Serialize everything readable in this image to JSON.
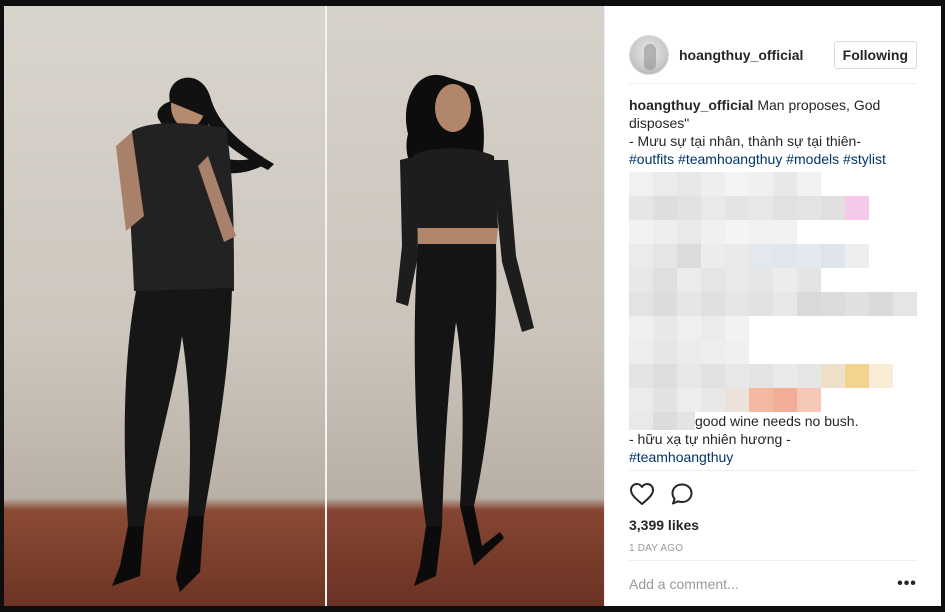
{
  "post": {
    "username": "hoangthuy_official",
    "follow_label": "Following"
  },
  "caption": {
    "username": "hoangthuy_official",
    "text_line1": " Man proposes, God disposes\"",
    "text_line2": "- Mưu sự tại nhân, thành sự tại thiên-",
    "hashtags": [
      "#outfits",
      "#teamhoangthuy",
      "#models",
      "#stylist"
    ],
    "text_line3": "good wine needs no bush.",
    "text_line4": "- hữu xạ tự nhiên hương -",
    "hashtag_end": "#teamhoangthuy"
  },
  "mosaic_colors": [
    [
      "#f1f1f1",
      "#ebebeb",
      "#e7e7e7",
      "#eeeeee",
      "#f3f3f3",
      "#f0f0f0",
      "#e8e8e8",
      "#f2f2f2",
      "#ffffff",
      "#ffffff",
      "#ffffff",
      "#ffffff"
    ],
    [
      "#e6e6e6",
      "#dedede",
      "#e2e2e2",
      "#e9e9e9",
      "#e4e4e4",
      "#e7e7e7",
      "#e1e1e1",
      "#e3e3e3",
      "#dfdfdf",
      "#f6c9ea",
      "#ffffff",
      "#ffffff"
    ],
    [
      "#f2f2f2",
      "#eeeeee",
      "#e9e9e9",
      "#f0f0f0",
      "#f4f4f4",
      "#f2f2f2",
      "#f1f1f1",
      "#ffffff",
      "#ffffff",
      "#ffffff",
      "#ffffff",
      "#ffffff"
    ],
    [
      "#ebebeb",
      "#e5e5e5",
      "#dbdbdb",
      "#ececec",
      "#eaeaea",
      "#e3e7ee",
      "#e1e6ed",
      "#e4e8ef",
      "#dfe4eb",
      "#eeeeee",
      "#ffffff",
      "#ffffff"
    ],
    [
      "#e8e8e8",
      "#dfdfdf",
      "#ebebeb",
      "#e5e5e5",
      "#e9e9e9",
      "#e6e6e6",
      "#ececec",
      "#e4e4e4",
      "#ffffff",
      "#ffffff",
      "#ffffff",
      "#ffffff"
    ],
    [
      "#e3e3e3",
      "#dcdcdc",
      "#e6e6e6",
      "#e0e0e0",
      "#e5e5e5",
      "#e2e2e2",
      "#e7e7e7",
      "#d9d9d9",
      "#dcdcdc",
      "#e0e0e0",
      "#dadada",
      "#e5e5e5"
    ],
    [
      "#f0f0f0",
      "#e8e8e8",
      "#efefef",
      "#ebebeb",
      "#f2f2f2",
      "#ffffff",
      "#ffffff",
      "#ffffff",
      "#ffffff",
      "#ffffff",
      "#ffffff",
      "#ffffff"
    ],
    [
      "#ededed",
      "#e6e6e6",
      "#ebebeb",
      "#eeeeee",
      "#f0f0f0",
      "#ffffff",
      "#ffffff",
      "#ffffff",
      "#ffffff",
      "#ffffff",
      "#ffffff",
      "#ffffff"
    ],
    [
      "#e4e4e4",
      "#dddddd",
      "#e8e8e8",
      "#e1e1e1",
      "#e7e7e7",
      "#e3e3e3",
      "#e9e9e9",
      "#e5e5e5",
      "#eee0c8",
      "#f3d38e",
      "#f8edd4",
      "#ffffff"
    ],
    [
      "#ebebeb",
      "#e2e2e2",
      "#ededed",
      "#e8e8e8",
      "#ebe2da",
      "#f4b8a2",
      "#f2ad96",
      "#f5c8b8",
      "#ffffff",
      "#ffffff",
      "#ffffff",
      "#ffffff"
    ]
  ],
  "actions": {
    "likes": "3,399 likes",
    "timestamp": "1 DAY AGO"
  },
  "comment": {
    "placeholder": "Add a comment...",
    "more_label": "•••"
  },
  "icons": {
    "like": "heart-outline-icon",
    "comment": "speech-bubble-icon",
    "options": "ellipsis-icon"
  }
}
